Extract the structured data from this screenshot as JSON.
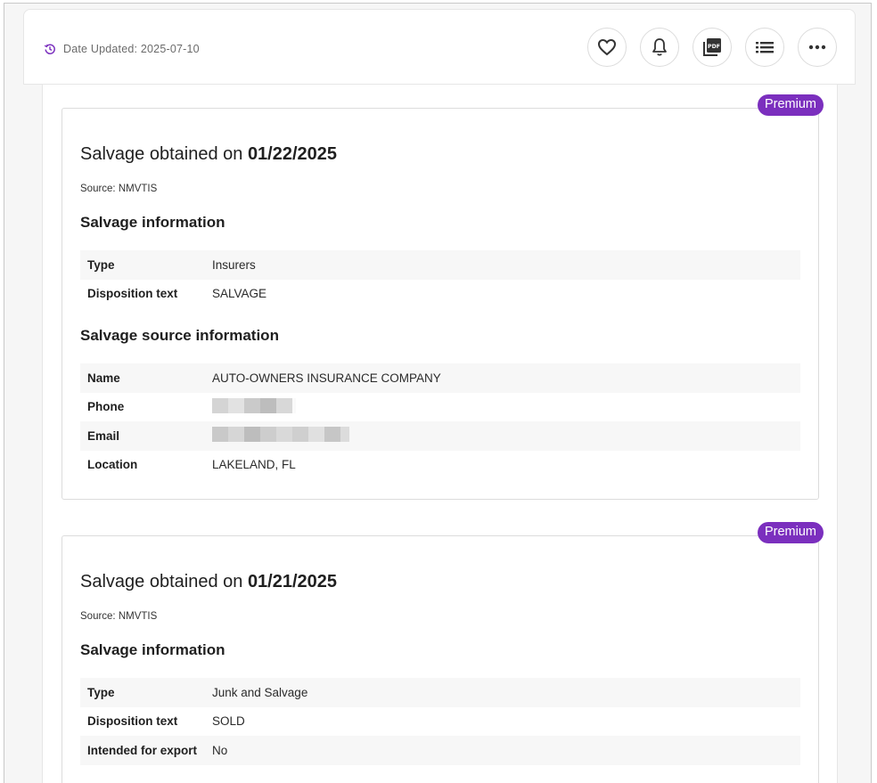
{
  "header": {
    "date_updated_label": "Date Updated: 2025-07-10",
    "actions": [
      {
        "name": "favorite-button",
        "icon": "heart-icon"
      },
      {
        "name": "notifications-button",
        "icon": "bell-icon"
      },
      {
        "name": "pdf-button",
        "icon": "pdf-icon"
      },
      {
        "name": "list-button",
        "icon": "list-icon"
      },
      {
        "name": "more-button",
        "icon": "more-icon"
      }
    ]
  },
  "colors": {
    "accent": "#7b2fbe",
    "row_stripe": "#f7f7f7"
  },
  "cards": [
    {
      "badge": "Premium",
      "title_prefix": "Salvage obtained on ",
      "title_date": "01/22/2025",
      "source": "Source: NMVTIS",
      "salvage_info_title": "Salvage information",
      "salvage_info": [
        {
          "label": "Type",
          "value": "Insurers"
        },
        {
          "label": "Disposition text",
          "value": "SALVAGE"
        }
      ],
      "source_info_title": "Salvage source information",
      "source_info": [
        {
          "label": "Name",
          "value": "AUTO-OWNERS INSURANCE COMPANY"
        },
        {
          "label": "Phone",
          "value": ""
        },
        {
          "label": "Email",
          "value": ""
        },
        {
          "label": "Location",
          "value": "LAKELAND, FL"
        }
      ]
    },
    {
      "badge": "Premium",
      "title_prefix": "Salvage obtained on ",
      "title_date": "01/21/2025",
      "source": "Source: NMVTIS",
      "salvage_info_title": "Salvage information",
      "salvage_info": [
        {
          "label": "Type",
          "value": "Junk and Salvage"
        },
        {
          "label": "Disposition text",
          "value": "SOLD"
        },
        {
          "label": "Intended for export",
          "value": "No"
        }
      ]
    }
  ]
}
